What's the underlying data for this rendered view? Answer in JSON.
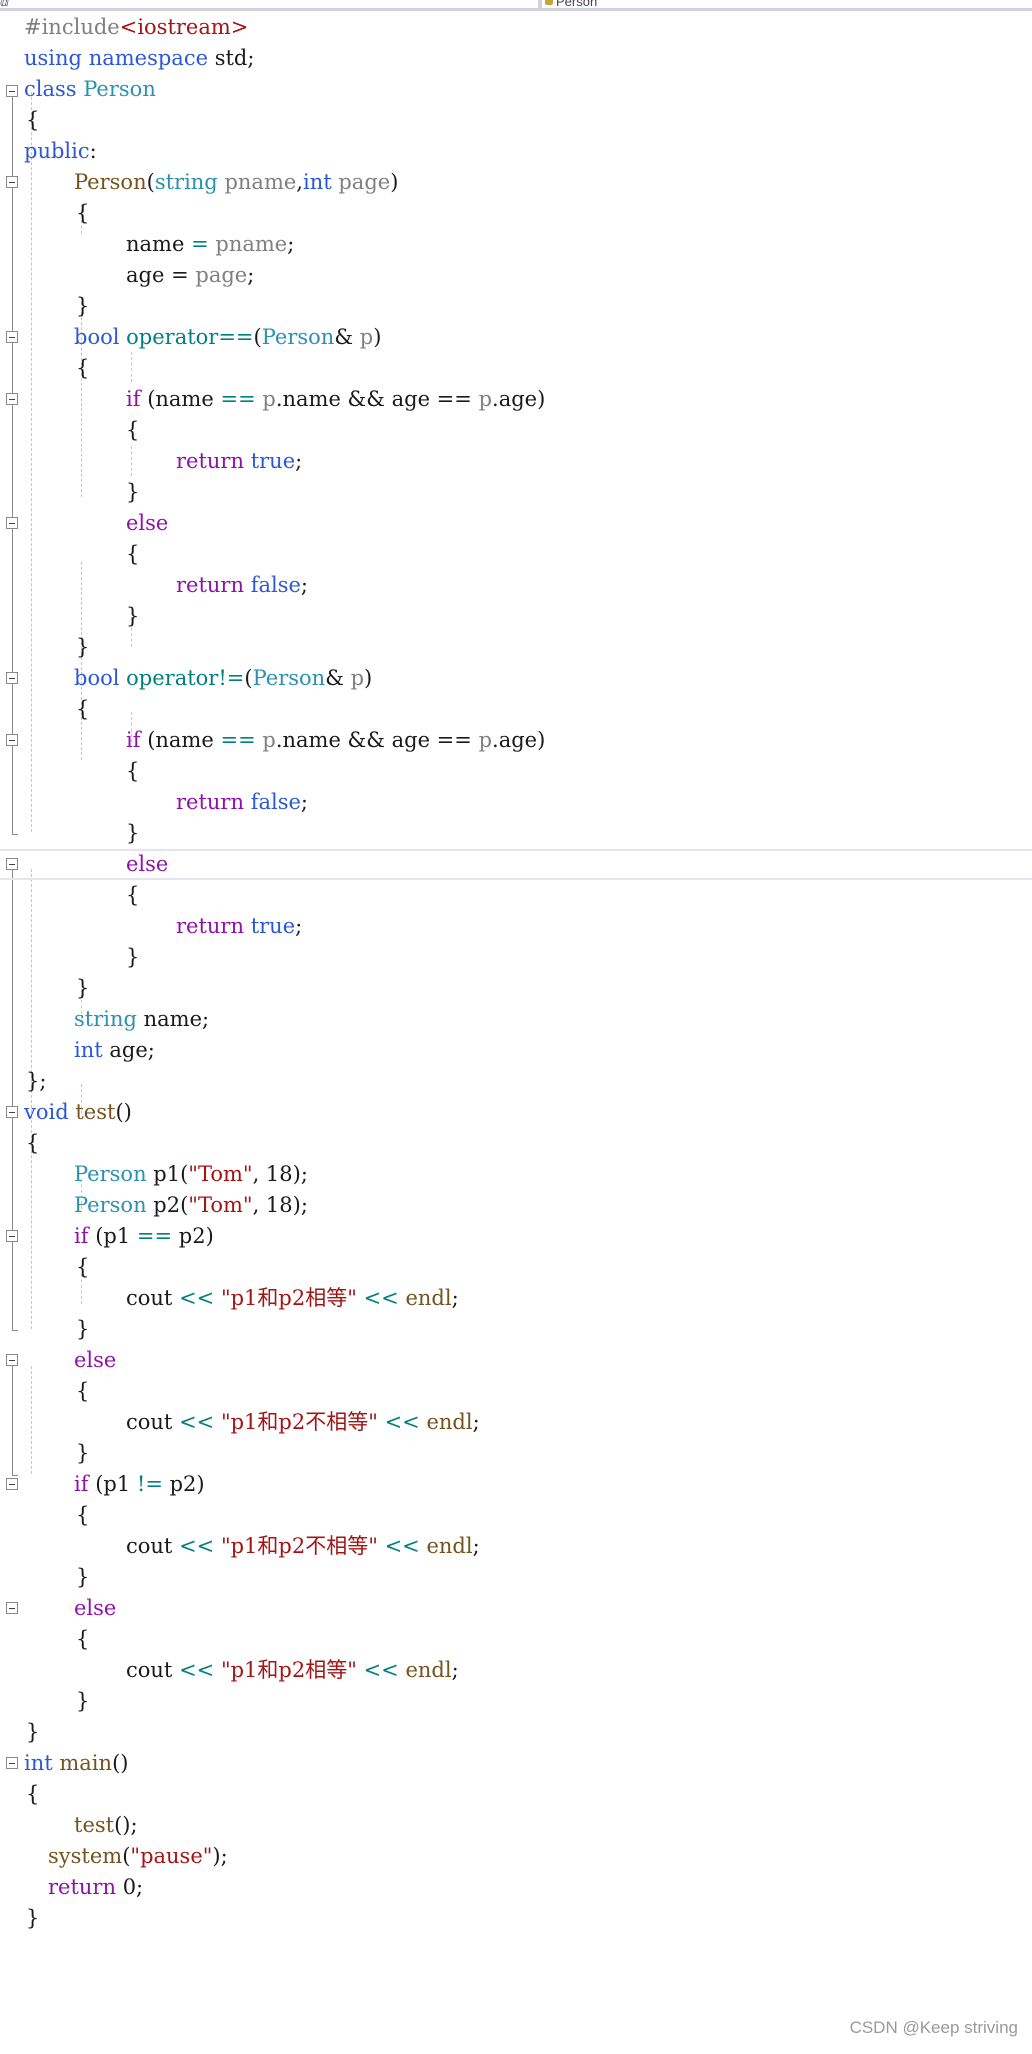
{
  "tab": {
    "left_glyph": "ⅆ",
    "breadcrumb": "Person"
  },
  "code": {
    "l1": [
      "#include",
      "<iostream>"
    ],
    "l2": [
      "using",
      "namespace",
      "std;"
    ],
    "l3": [
      "class",
      "Person"
    ],
    "l4": "{",
    "l5": [
      "public",
      ":"
    ],
    "l6": [
      "Person",
      "(",
      "string",
      "pname",
      ",",
      "int",
      "page",
      ")"
    ],
    "l7": "{",
    "l8": [
      "name",
      "=",
      "pname",
      ";"
    ],
    "l9": [
      "age",
      "=",
      "page",
      ";"
    ],
    "l10": "}",
    "l11": [
      "bool",
      "operator==",
      "(",
      "Person",
      "&",
      "p",
      ")"
    ],
    "l12": "{",
    "l13": [
      "if",
      "(name",
      "==",
      "p",
      ".name && age ==",
      "p",
      ".age)"
    ],
    "l14": "{",
    "l15": [
      "return",
      "true",
      ";"
    ],
    "l16": "}",
    "l17": "else",
    "l18": "{",
    "l19": [
      "return",
      "false",
      ";"
    ],
    "l20": "}",
    "l21": "}",
    "l22": [
      "bool",
      "operator!=",
      "(",
      "Person",
      "&",
      "p",
      ")"
    ],
    "l23": "{",
    "l24": [
      "if",
      "(name",
      "==",
      "p",
      ".name && age ==",
      "p",
      ".age)"
    ],
    "l25": "{",
    "l26": [
      "return",
      "false",
      ";"
    ],
    "l27": "}",
    "l28": "else",
    "l29": "{",
    "l30": [
      "return",
      "true",
      ";"
    ],
    "l31": "}",
    "l32": "}",
    "l33": [
      "string",
      "name;"
    ],
    "l34": [
      "int",
      "age;"
    ],
    "l35": "};",
    "l36": [
      "void",
      "test",
      "()"
    ],
    "l37": "{",
    "l38": [
      "Person",
      "p1(",
      "\"Tom\"",
      ", 18);"
    ],
    "l39": [
      "Person",
      "p2(",
      "\"Tom\"",
      ", 18);"
    ],
    "l40": [
      "if",
      "(p1",
      "==",
      "p2)"
    ],
    "l41": "{",
    "l42": [
      "cout",
      "<<",
      "\"p1和p2相等\"",
      "<<",
      "endl",
      ";"
    ],
    "l43": "}",
    "l44": "else",
    "l45": "{",
    "l46": [
      "cout",
      "<<",
      "\"p1和p2不相等\"",
      "<<",
      "endl",
      ";"
    ],
    "l47": "}",
    "l48": [
      "if",
      "(p1",
      "!=",
      "p2)"
    ],
    "l49": "{",
    "l50": [
      "cout",
      "<<",
      "\"p1和p2不相等\"",
      "<<",
      "endl",
      ";"
    ],
    "l51": "}",
    "l52": "else",
    "l53": "{",
    "l54": [
      "cout",
      "<<",
      "\"p1和p2相等\"",
      "<<",
      "endl",
      ";"
    ],
    "l55": "}",
    "l56": "}",
    "l57": [
      "int",
      "main",
      "()"
    ],
    "l58": "{",
    "l59": [
      "test",
      "();"
    ],
    "l60": [
      "system",
      "(",
      "\"pause\"",
      ");"
    ],
    "l61": [
      "return",
      "0;"
    ],
    "l62": "}"
  },
  "watermark": "CSDN @Keep striving",
  "colors": {
    "keyword": "#2b57d8",
    "control_keyword": "#8f12a8",
    "type": "#2b91af",
    "function": "#74531f",
    "parameter": "#808080",
    "string": "#a31515",
    "operator": "#008080",
    "current_line_border": "#e3e6ee"
  }
}
